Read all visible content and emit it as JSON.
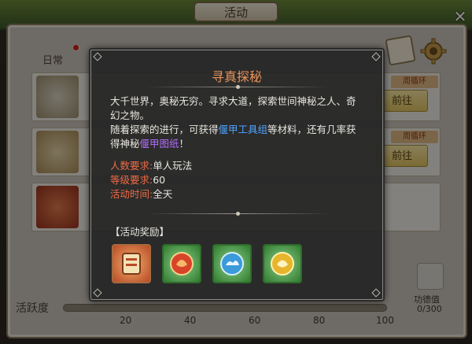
{
  "window": {
    "title": "活动",
    "close_glyph": "✕"
  },
  "tabs": {
    "daily": "日常"
  },
  "list": [
    {
      "tag": "周循环",
      "go": "前往"
    },
    {
      "tag": "周循环",
      "go": "前往"
    },
    {
      "tag": "",
      "go": ""
    }
  ],
  "progress": {
    "label": "活跃度",
    "ticks": [
      "20",
      "40",
      "60",
      "80",
      "100"
    ],
    "merit_label": "功德值",
    "merit_value": "0/300"
  },
  "popup": {
    "title": "寻真探秘",
    "desc_1": "大千世界，奥秘无穷。寻求大道，探索世间神秘之人、奇幻之物。",
    "desc_2a": "随着探索的进行，可获得",
    "desc_2b": "偃甲工具组",
    "desc_2c": "等材料，还有几率获得神秘",
    "desc_2d": "偃甲图纸",
    "desc_2e": "！",
    "requirements": [
      {
        "key": "人数要求:",
        "value": "单人玩法"
      },
      {
        "key": "等级要求:",
        "value": "60"
      },
      {
        "key": "活动时间:",
        "value": "全天"
      }
    ],
    "rewards_title": "【活动奖励】",
    "rewards": [
      {
        "icon": "scroll-bundle-icon",
        "color": "#b94a25"
      },
      {
        "icon": "red-phoenix-orb-icon",
        "color": "#3f8a3a"
      },
      {
        "icon": "blue-cloud-orb-icon",
        "color": "#3f8a3a"
      },
      {
        "icon": "gold-orb-icon",
        "color": "#3f8a3a"
      }
    ]
  },
  "colors": {
    "accent_title": "#e8935a",
    "req_key": "#ef6a45",
    "link_blue": "#4fa3ff",
    "link_purple": "#b46dff"
  }
}
